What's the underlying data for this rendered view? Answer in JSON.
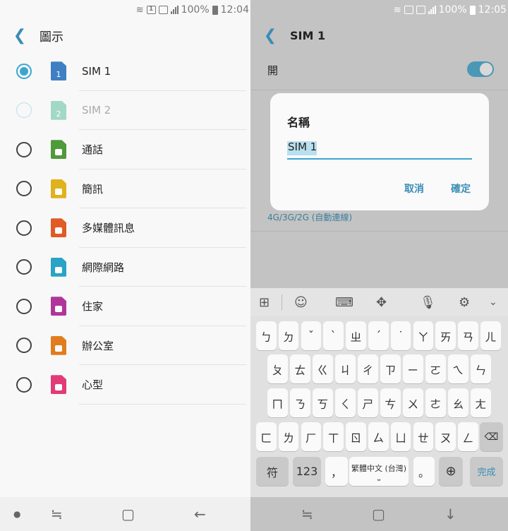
{
  "left": {
    "status": {
      "battery": "100%",
      "time": "12:04",
      "sim_badge": "1"
    },
    "header": {
      "title": "圖示"
    },
    "icons": [
      {
        "label": "SIM 1",
        "selected": true,
        "dim": false,
        "color": "#3f7fc4",
        "badge": "1",
        "icon": "sim-1-icon"
      },
      {
        "label": "SIM 2",
        "selected": false,
        "dim": true,
        "color": "#a2d8c6",
        "badge": "2",
        "icon": "sim-2-icon"
      },
      {
        "label": "通話",
        "selected": false,
        "dim": false,
        "color": "#4f9a3b",
        "badge": "",
        "icon": "phone-icon"
      },
      {
        "label": "簡訊",
        "selected": false,
        "dim": false,
        "color": "#e0b21b",
        "badge": "",
        "icon": "message-icon"
      },
      {
        "label": "多媒體訊息",
        "selected": false,
        "dim": false,
        "color": "#e05b26",
        "badge": "",
        "icon": "mms-icon"
      },
      {
        "label": "網際網路",
        "selected": false,
        "dim": false,
        "color": "#29a3c6",
        "badge": "",
        "icon": "globe-icon"
      },
      {
        "label": "住家",
        "selected": false,
        "dim": false,
        "color": "#b0359a",
        "badge": "",
        "icon": "home-icon"
      },
      {
        "label": "辦公室",
        "selected": false,
        "dim": false,
        "color": "#e27c1e",
        "badge": "",
        "icon": "office-icon"
      },
      {
        "label": "心型",
        "selected": false,
        "dim": false,
        "color": "#e13b78",
        "badge": "",
        "icon": "heart-icon"
      }
    ]
  },
  "right": {
    "status": {
      "battery": "100%",
      "time": "12:05"
    },
    "header": {
      "title": "SIM 1"
    },
    "power": {
      "label": "開",
      "on": true
    },
    "network_value": "4G/3G/2G (自動連線)",
    "dialog": {
      "title": "名稱",
      "value": "SIM 1",
      "cancel": "取消",
      "confirm": "確定"
    },
    "keyboard": {
      "toolbar_icons": [
        "grid-plus-icon",
        "emoji-icon",
        "keyboard-icon",
        "move-icon",
        "mic-icon",
        "gear-icon",
        "chevron-down-icon"
      ],
      "row1": [
        "ㄅ",
        "ㄉ",
        "ˇ",
        "ˋ",
        "ㄓ",
        "ˊ",
        "˙",
        "ㄚ",
        "ㄞ",
        "ㄢ",
        "ㄦ"
      ],
      "row2": [
        "ㄆ",
        "ㄊ",
        "ㄍ",
        "ㄐ",
        "ㄔ",
        "ㄗ",
        "ㄧ",
        "ㄛ",
        "ㄟ",
        "ㄣ"
      ],
      "row3": [
        "ㄇ",
        "ㄋ",
        "ㄎ",
        "ㄑ",
        "ㄕ",
        "ㄘ",
        "ㄨ",
        "ㄜ",
        "ㄠ",
        "ㄤ"
      ],
      "row4": [
        "ㄈ",
        "ㄌ",
        "ㄏ",
        "ㄒ",
        "ㄖ",
        "ㄙ",
        "ㄩ",
        "ㄝ",
        "ㄡ",
        "ㄥ"
      ],
      "symbol_key": "符",
      "number_key": "123",
      "comma_key": "，",
      "space_label": "繁體中文 (台灣)",
      "period_key": "。",
      "done_key": "完成"
    }
  }
}
